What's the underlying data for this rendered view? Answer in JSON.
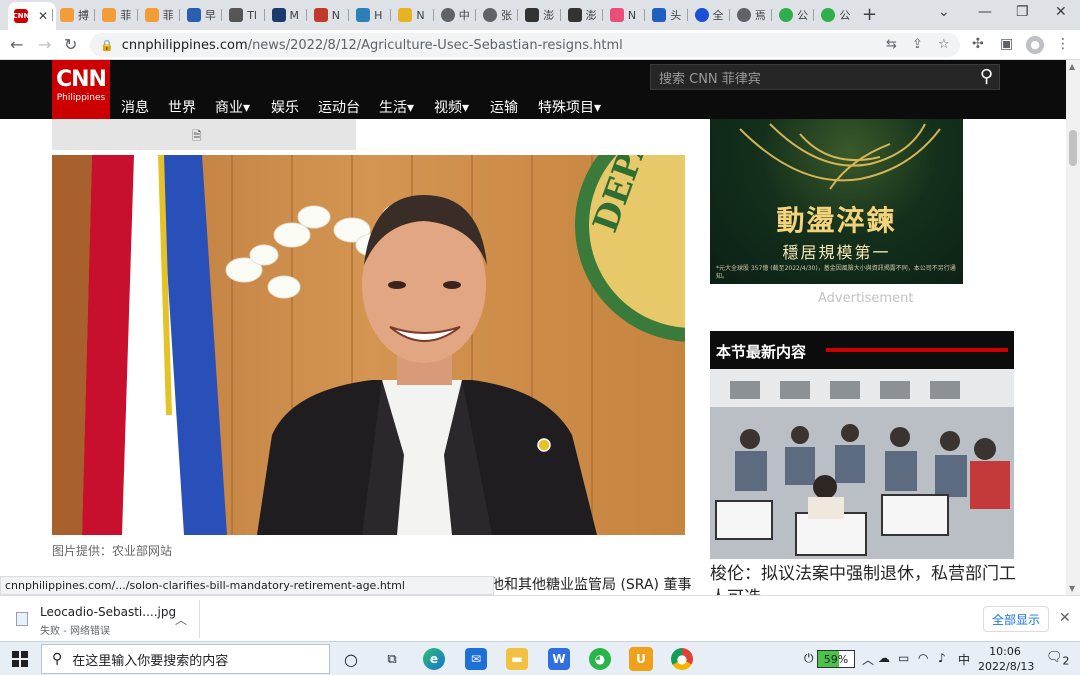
{
  "browser": {
    "tabs": [
      {
        "label": "",
        "icon": "cnn-favicon",
        "active": true
      },
      {
        "label": "搏",
        "icon": "orange-favicon"
      },
      {
        "label": "菲",
        "icon": "orange-favicon"
      },
      {
        "label": "菲",
        "icon": "orange-favicon"
      },
      {
        "label": "早",
        "icon": "md-favicon"
      },
      {
        "label": "Tl",
        "icon": "tl-favicon"
      },
      {
        "label": "M",
        "icon": "mb-favicon"
      },
      {
        "label": "N",
        "icon": "radio-favicon"
      },
      {
        "label": "H",
        "icon": "phi-favicon"
      },
      {
        "label": "N",
        "icon": "play-favicon"
      },
      {
        "label": "中",
        "icon": "globe-favicon"
      },
      {
        "label": "张",
        "icon": "globe-favicon"
      },
      {
        "label": "澎",
        "icon": "thepaper-favicon"
      },
      {
        "label": "澎",
        "icon": "thepaper-favicon"
      },
      {
        "label": "N",
        "icon": "colorful-favicon"
      },
      {
        "label": "头",
        "icon": "toutiao-favicon"
      },
      {
        "label": "全",
        "icon": "blue-circle-favicon"
      },
      {
        "label": "焉",
        "icon": "globe-favicon"
      },
      {
        "label": "公",
        "icon": "green-favicon"
      },
      {
        "label": "公",
        "icon": "green-favicon"
      }
    ],
    "new_tab_label": "+",
    "url_host": "cnnphilippines.com",
    "url_path": "/news/2022/8/12/Agriculture-Usec-Sebastian-resigns.html",
    "status_url": "cnnphilippines.com/.../solon-clarifies-bill-mandatory-retirement-age.html"
  },
  "site": {
    "logo_main": "CNN",
    "logo_sub": "Philippines",
    "nav": [
      "消息",
      "世界",
      "商业▾",
      "娱乐",
      "运动台",
      "生活▾",
      "视频▾",
      "运输",
      "特殊项目▾"
    ],
    "search_placeholder": "搜索 CNN 菲律宾"
  },
  "article": {
    "caption": "图片提供：农业部网站",
    "body_fragment": "他和其他糖业监管局 (SRA) 董事"
  },
  "sidebar": {
    "ad_title": "動盪淬鍊",
    "ad_subtitle": "穩居規模第一",
    "ad_fine": "*元大全球股 357億 (截至2022/4/30)，基金因風險大小與資訊揭露不同，本公司不另行通知。",
    "ad_label": "Advertisement",
    "latest_title": "本节最新内容",
    "latest_headline": "梭伦：拟议法案中强制退休，私营部门工人可选"
  },
  "download": {
    "filename": "Leocadio-Sebasti....jpg",
    "status": "失败 - 网络错误",
    "show_all": "全部显示"
  },
  "taskbar": {
    "search_placeholder": "在这里输入你要搜索的内容",
    "battery": "59%",
    "battery_level": 0.59,
    "ime": "中",
    "time": "10:06",
    "date": "2022/8/13",
    "notifications": "2"
  }
}
